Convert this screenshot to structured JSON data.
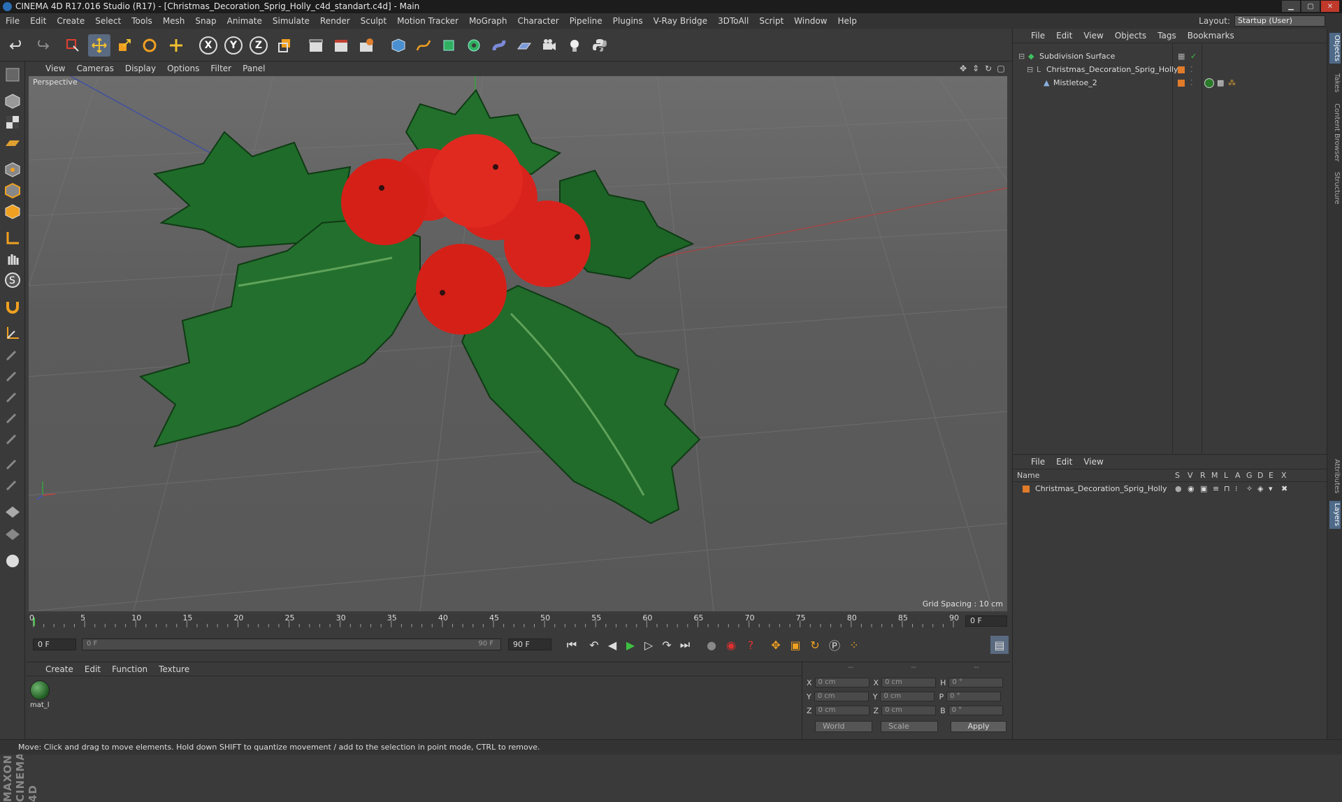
{
  "window": {
    "title": "CINEMA 4D R17.016 Studio (R17) - [Christmas_Decoration_Sprig_Holly_c4d_standart.c4d] - Main"
  },
  "menubar": {
    "items": [
      "File",
      "Edit",
      "Create",
      "Select",
      "Tools",
      "Mesh",
      "Snap",
      "Animate",
      "Simulate",
      "Render",
      "Sculpt",
      "Motion Tracker",
      "MoGraph",
      "Character",
      "Pipeline",
      "Plugins",
      "V-Ray Bridge",
      "3DToAll",
      "Script",
      "Window",
      "Help"
    ]
  },
  "layout": {
    "label": "Layout:",
    "value": "Startup (User)"
  },
  "toolbar": {
    "axes": [
      "X",
      "Y",
      "Z"
    ]
  },
  "viewport": {
    "menu": [
      "View",
      "Cameras",
      "Display",
      "Options",
      "Filter",
      "Panel"
    ],
    "label": "Perspective",
    "grid_spacing": "Grid Spacing : 10 cm"
  },
  "timeline": {
    "ticks": [
      "0",
      "5",
      "10",
      "15",
      "20",
      "25",
      "30",
      "35",
      "40",
      "45",
      "50",
      "55",
      "60",
      "65",
      "70",
      "75",
      "80",
      "85",
      "90"
    ],
    "current_frame": "0 F"
  },
  "transport": {
    "start_frame": "0 F",
    "range_start": "0 F",
    "range_end": "90 F",
    "end_frame": "90 F"
  },
  "materials": {
    "menu": [
      "Create",
      "Edit",
      "Function",
      "Texture"
    ],
    "items": [
      {
        "label": "mat_l"
      }
    ]
  },
  "coordinates": {
    "headers": [
      "--",
      "--",
      "--"
    ],
    "rows": [
      {
        "a": "X",
        "av": "0 cm",
        "b": "X",
        "bv": "0 cm",
        "c": "H",
        "cv": "0 °"
      },
      {
        "a": "Y",
        "av": "0 cm",
        "b": "Y",
        "bv": "0 cm",
        "c": "P",
        "cv": "0 °"
      },
      {
        "a": "Z",
        "av": "0 cm",
        "b": "Z",
        "bv": "0 cm",
        "c": "B",
        "cv": "0 °"
      }
    ],
    "mode": "World",
    "size_mode": "Scale",
    "apply": "Apply"
  },
  "object_manager": {
    "menu": [
      "File",
      "Edit",
      "View",
      "Objects",
      "Tags",
      "Bookmarks"
    ],
    "objects": [
      {
        "name": "Subdivision Surface"
      },
      {
        "name": "Christmas_Decoration_Sprig_Holly"
      },
      {
        "name": "Mistletoe_2"
      }
    ]
  },
  "layer_manager": {
    "menu": [
      "File",
      "Edit",
      "View"
    ],
    "columns": [
      "Name",
      "S",
      "V",
      "R",
      "M",
      "L",
      "A",
      "G",
      "D",
      "E",
      "X"
    ],
    "layers": [
      {
        "name": "Christmas_Decoration_Sprig_Holly"
      }
    ]
  },
  "right_tabs": [
    "Objects",
    "Takes",
    "Content Browser",
    "Structure",
    "Attributes",
    "Layers"
  ],
  "status": {
    "text": "Move: Click and drag to move elements. Hold down SHIFT to quantize movement / add to the selection in point mode, CTRL to remove."
  },
  "colors": {
    "berry": "#d8231c",
    "leaf": "#1f6b2a",
    "accent": "#e07b2a",
    "select": "#5a6a80"
  },
  "logo": "MAXON CINEMA 4D"
}
